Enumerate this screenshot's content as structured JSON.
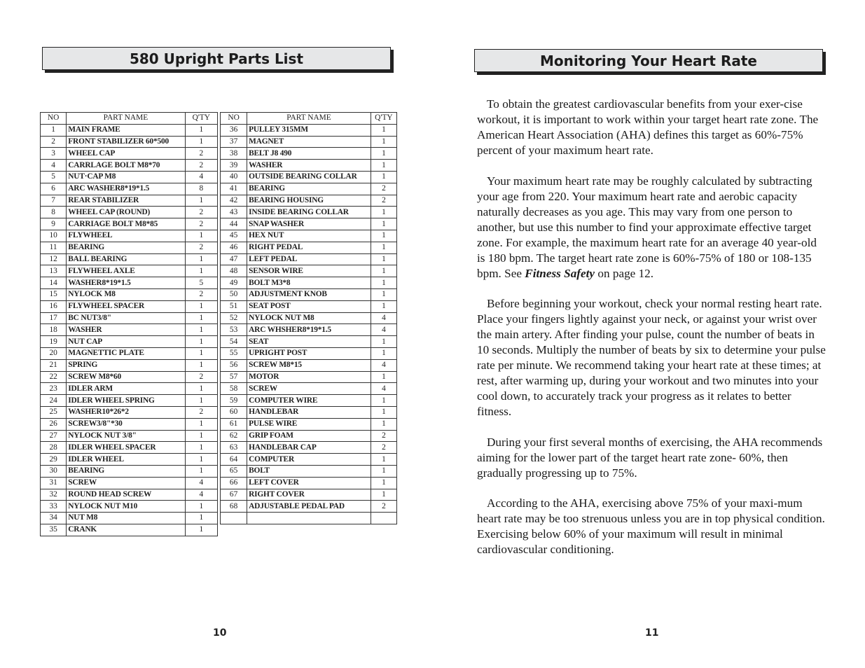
{
  "left_page": {
    "title": "580 Upright Parts List",
    "page_number": "10",
    "table_headers": {
      "no": "NO",
      "name": "PART NAME",
      "qty": "Q'TY"
    },
    "parts_col1": [
      {
        "no": "1",
        "name": "MAIN FRAME",
        "qty": "1"
      },
      {
        "no": "2",
        "name": "FRONT STABILIZER  60*500",
        "qty": "1"
      },
      {
        "no": "3",
        "name": "WHEEL CAP",
        "qty": "2"
      },
      {
        "no": "4",
        "name": "CARRLAGE BOLT M8*70",
        "qty": "2"
      },
      {
        "no": "5",
        "name": "NUT·CAP M8",
        "qty": "4"
      },
      {
        "no": "6",
        "name": "ARC WASHER8*19*1.5",
        "qty": "8"
      },
      {
        "no": "7",
        "name": "REAR STABILIZER",
        "qty": "1"
      },
      {
        "no": "8",
        "name": "WHEEL CAP (ROUND)",
        "qty": "2"
      },
      {
        "no": "9",
        "name": "CARRIAGE BOLT M8*85",
        "qty": "2"
      },
      {
        "no": "10",
        "name": "FLYWHEEL",
        "qty": "1"
      },
      {
        "no": "11",
        "name": "BEARING",
        "qty": "2"
      },
      {
        "no": "12",
        "name": "BALL BEARING",
        "qty": "1"
      },
      {
        "no": "13",
        "name": "FLYWHEEL AXLE",
        "qty": "1"
      },
      {
        "no": "14",
        "name": "WASHER8*19*1.5",
        "qty": "5"
      },
      {
        "no": "15",
        "name": "NYLOCK M8",
        "qty": "2"
      },
      {
        "no": "16",
        "name": "FLYWHEEL SPACER",
        "qty": "1"
      },
      {
        "no": "17",
        "name": "BC NUT3/8\"",
        "qty": "1"
      },
      {
        "no": "18",
        "name": "WASHER",
        "qty": "1"
      },
      {
        "no": "19",
        "name": "NUT CAP",
        "qty": "1"
      },
      {
        "no": "20",
        "name": "MAGNETTIC PLATE",
        "qty": "1"
      },
      {
        "no": "21",
        "name": "SPRING",
        "qty": "1"
      },
      {
        "no": "22",
        "name": "SCREW M8*60",
        "qty": "2"
      },
      {
        "no": "23",
        "name": "IDLER ARM",
        "qty": "1"
      },
      {
        "no": "24",
        "name": "IDLER WHEEL SPRING",
        "qty": "1"
      },
      {
        "no": "25",
        "name": "WASHER10*26*2",
        "qty": "2"
      },
      {
        "no": "26",
        "name": "SCREW3/8\"*30",
        "qty": "1"
      },
      {
        "no": "27",
        "name": "NYLOCK NUT 3/8\"",
        "qty": "1"
      },
      {
        "no": "28",
        "name": "IDLER WHEEL SPACER",
        "qty": "1"
      },
      {
        "no": "29",
        "name": "IDLER WHEEL",
        "qty": "1"
      },
      {
        "no": "30",
        "name": "BEARING",
        "qty": "1"
      },
      {
        "no": "31",
        "name": "SCREW",
        "qty": "4"
      },
      {
        "no": "32",
        "name": "ROUND HEAD SCREW",
        "qty": "4"
      },
      {
        "no": "33",
        "name": "NYLOCK NUT M10",
        "qty": "1"
      },
      {
        "no": "34",
        "name": "NUT M8",
        "qty": "1"
      },
      {
        "no": "35",
        "name": "CRANK",
        "qty": "1"
      }
    ],
    "parts_col2": [
      {
        "no": "36",
        "name": "PULLEY  315MM",
        "qty": "1"
      },
      {
        "no": "37",
        "name": "MAGNET",
        "qty": "1"
      },
      {
        "no": "38",
        "name": "BELT    J8  490",
        "qty": "1"
      },
      {
        "no": "39",
        "name": "WASHER",
        "qty": "1"
      },
      {
        "no": "40",
        "name": "OUTSIDE BEARING COLLAR",
        "qty": "1"
      },
      {
        "no": "41",
        "name": "BEARING",
        "qty": "2"
      },
      {
        "no": "42",
        "name": "BEARING HOUSING",
        "qty": "2"
      },
      {
        "no": "43",
        "name": "INSIDE BEARING COLLAR",
        "qty": "1"
      },
      {
        "no": "44",
        "name": "SNAP WASHER",
        "qty": "1"
      },
      {
        "no": "45",
        "name": "HEX NUT",
        "qty": "1"
      },
      {
        "no": "46",
        "name": "RIGHT PEDAL",
        "qty": "1"
      },
      {
        "no": "47",
        "name": "LEFT PEDAL",
        "qty": "1"
      },
      {
        "no": "48",
        "name": "SENSOR WIRE",
        "qty": "1"
      },
      {
        "no": "49",
        "name": "BOLT M3*8",
        "qty": "1"
      },
      {
        "no": "50",
        "name": "ADJUSTMENT KNOB",
        "qty": "1"
      },
      {
        "no": "51",
        "name": "SEAT POST",
        "qty": "1"
      },
      {
        "no": "52",
        "name": "NYLOCK NUT M8",
        "qty": "4"
      },
      {
        "no": "53",
        "name": "ARC WHSHER8*19*1.5",
        "qty": "4"
      },
      {
        "no": "54",
        "name": "SEAT",
        "qty": "1"
      },
      {
        "no": "55",
        "name": "UPRIGHT POST",
        "qty": "1"
      },
      {
        "no": "56",
        "name": "SCREW M8*15",
        "qty": "4"
      },
      {
        "no": "57",
        "name": "MOTOR",
        "qty": "1"
      },
      {
        "no": "58",
        "name": "SCREW",
        "qty": "4"
      },
      {
        "no": "59",
        "name": "COMPUTER WIRE",
        "qty": "1"
      },
      {
        "no": "60",
        "name": "HANDLEBAR",
        "qty": "1"
      },
      {
        "no": "61",
        "name": "PULSE WIRE",
        "qty": "1"
      },
      {
        "no": "62",
        "name": "GRIP FOAM",
        "qty": "2"
      },
      {
        "no": "63",
        "name": "HANDLEBAR CAP",
        "qty": "2"
      },
      {
        "no": "64",
        "name": "COMPUTER",
        "qty": "1"
      },
      {
        "no": "65",
        "name": "BOLT",
        "qty": "1"
      },
      {
        "no": "66",
        "name": "LEFT COVER",
        "qty": "1"
      },
      {
        "no": "67",
        "name": "RIGHT COVER",
        "qty": "1"
      },
      {
        "no": "68",
        "name": "ADJUSTABLE PEDAL PAD",
        "qty": "2"
      },
      {
        "no": "",
        "name": "",
        "qty": ""
      }
    ]
  },
  "right_page": {
    "title": "Monitoring Your Heart Rate",
    "page_number": "11",
    "paragraphs": [
      {
        "text": "To obtain the greatest cardiovascular benefits from your exer-cise workout, it is important to work within your target heart rate zone. The American Heart Association (AHA) defines this target as 60%-75% percent of your maximum heart rate."
      },
      {
        "text": "Your maximum heart rate may be roughly calculated by subtracting your age from 220. Your maximum heart rate and aerobic capacity naturally decreases as you age. This may vary from one person to another, but use this number to find your approximate effective target zone. For example, the maximum heart rate for an average 40 year-old is 180 bpm. The target heart rate zone is 60%-75% of 180 or 108-135 bpm. See ",
        "emphasis": "Fitness Safety",
        "after": " on page 12."
      },
      {
        "text": "Before beginning your workout, check your normal resting heart rate. Place your fingers lightly against your neck, or against your wrist over the main artery. After finding your pulse, count the number of beats in 10 seconds. Multiply the number of beats by six to determine your pulse rate per minute. We recommend taking your heart rate at these times; at rest, after warming up, during your workout and two minutes into your cool down, to accurately track your progress as it relates to better fitness."
      },
      {
        "text": "During your first several months of exercising, the AHA recommends aiming for the lower part of the target heart rate zone- 60%, then gradually progressing up to 75%."
      },
      {
        "text": "According to the AHA, exercising above 75% of your maxi-mum heart rate may be too strenuous unless you are in top physical condition. Exercising below 60% of your maximum will result in minimal cardiovascular conditioning."
      }
    ]
  }
}
